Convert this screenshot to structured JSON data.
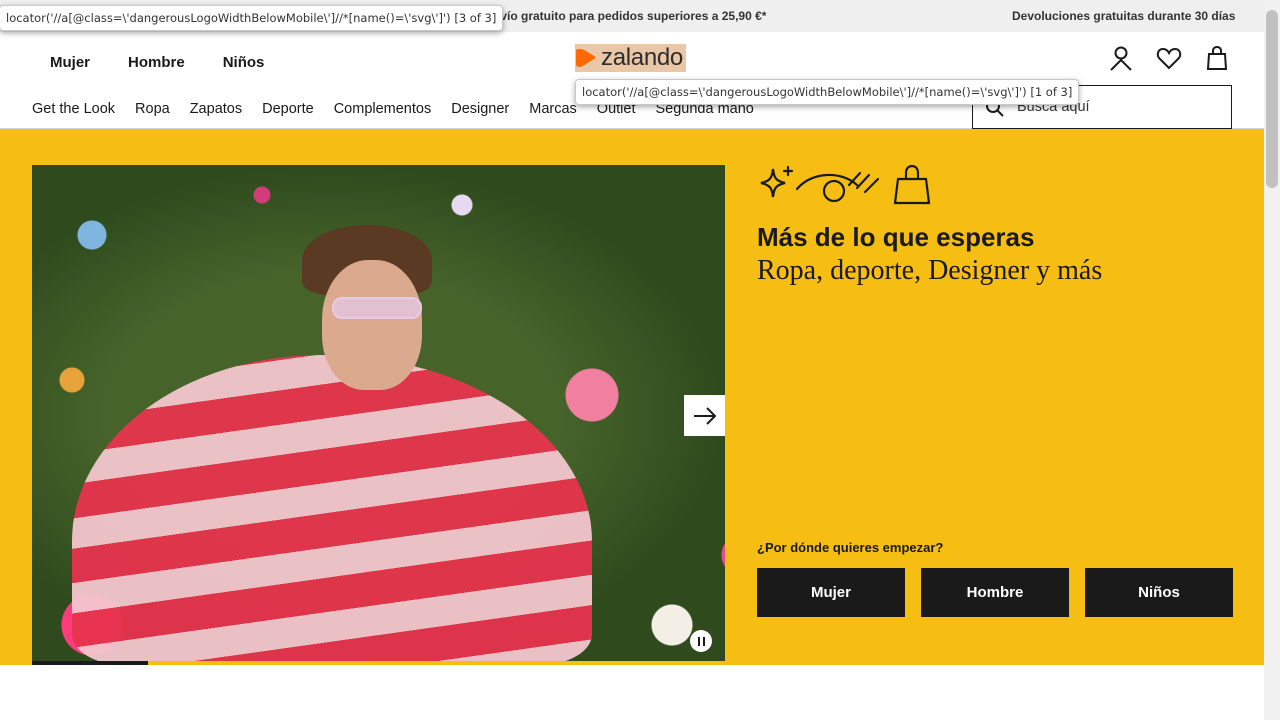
{
  "promo": {
    "shipping": "nvío gratuito para pedidos superiores a 25,90 €*",
    "returns": "Devoluciones gratuitas durante 30 días"
  },
  "header": {
    "logo_text": "zalando",
    "gender_nav": [
      "Mujer",
      "Hombre",
      "Niños"
    ],
    "icons": [
      "user-icon",
      "heart-icon",
      "bag-icon"
    ],
    "categories": [
      "Get the Look",
      "Ropa",
      "Zapatos",
      "Deporte",
      "Complementos",
      "Designer",
      "Marcas",
      "Outlet",
      "Segunda mano"
    ],
    "search_placeholder": "Busca aquí"
  },
  "tooltips": {
    "locator_a": "locator('//a[@class=\\'dangerousLogoWidthBelowMobile\\']//*[name()=\\'svg\\']') [3 of 3]",
    "locator_b": "locator('//a[@class=\\'dangerousLogoWidthBelowMobile\\']//*[name()=\\'svg\\']') [1 of 3]"
  },
  "hero": {
    "title": "Más de lo que esperas",
    "subtitle": "Ropa, deporte, Designer y más",
    "question": "¿Por dónde quieres empezar?",
    "buttons": [
      "Mujer",
      "Hombre",
      "Niños"
    ],
    "carousel_progress": 0.167
  },
  "colors": {
    "hero_bg": "#f6be12",
    "logo_orange": "#ff6900",
    "button_bg": "#1a1a1a"
  }
}
